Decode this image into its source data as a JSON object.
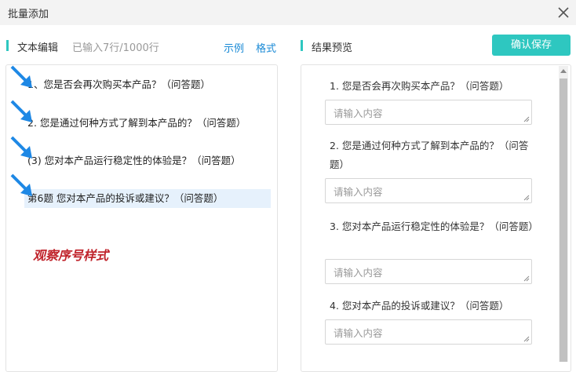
{
  "dialog": {
    "title": "批量添加",
    "close_icon": "close-icon"
  },
  "editor_panel": {
    "label": "文本编辑",
    "count": "已输入7行/1000行",
    "example_link": "示例",
    "format_link": "格式",
    "lines": [
      "1、您是否会再次购买本产品？（问答题）",
      "2. 您是通过何种方式了解到本产品的？（问答题）",
      "(3) 您对本产品运行稳定性的体验是？（问答题）",
      "第6题 您对本产品的投诉或建议？（问答题）"
    ],
    "annotation": "观察序号样式"
  },
  "preview_panel": {
    "label": "结果预览",
    "confirm_button": "确认保存",
    "questions": [
      {
        "text": "1. 您是否会再次购买本产品？（问答题）",
        "placeholder": "请输入内容"
      },
      {
        "text": "2. 您是通过何种方式了解到本产品的？（问答题）",
        "placeholder": "请输入内容"
      },
      {
        "text": "3. 您对本产品运行稳定性的体验是？（问答题）",
        "placeholder": "请输入内容"
      },
      {
        "text": "4. 您对本产品的投诉或建议？（问答题）",
        "placeholder": "请输入内容"
      }
    ]
  },
  "colors": {
    "accent": "#2ec7c0",
    "link": "#1a8ad6",
    "annotation": "#c0232b",
    "arrow": "#1e88e5"
  }
}
